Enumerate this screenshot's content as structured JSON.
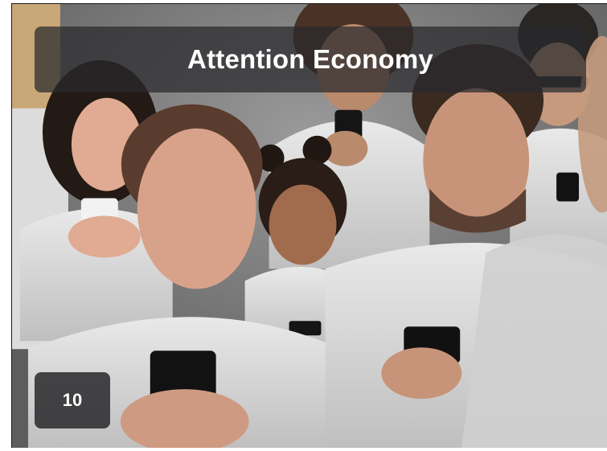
{
  "slide": {
    "title": "Attention Economy",
    "number": "10"
  },
  "photo": {
    "subject": "crowd-looking-at-phones"
  },
  "colors": {
    "banner_bg": "#28282c",
    "text": "#ffffff",
    "background": "#6f6f6f"
  }
}
